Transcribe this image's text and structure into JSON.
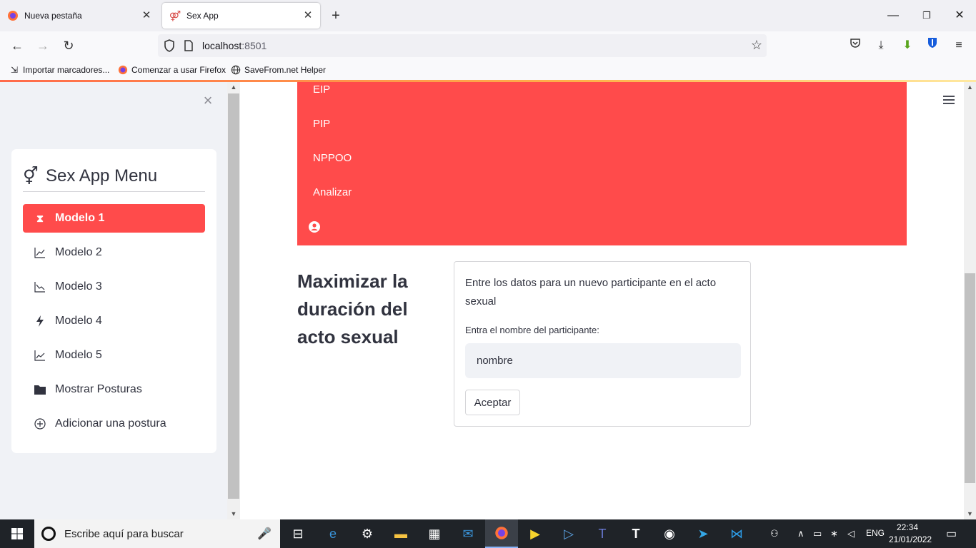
{
  "browser": {
    "tabs": [
      {
        "label": "Nueva pestaña"
      },
      {
        "label": "Sex App"
      }
    ],
    "url_host": "localhost",
    "url_port": ":8501",
    "bookmarks": [
      {
        "label": "Importar marcadores..."
      },
      {
        "label": "Comenzar a usar Firefox"
      },
      {
        "label": "SaveFrom.net Helper"
      }
    ]
  },
  "sidebar": {
    "title": "Sex App Menu",
    "items": [
      {
        "label": "Modelo 1",
        "icon": "hourglass-icon",
        "active": true
      },
      {
        "label": "Modelo 2",
        "icon": "chart-up-icon"
      },
      {
        "label": "Modelo 3",
        "icon": "chart-down-icon"
      },
      {
        "label": "Modelo 4",
        "icon": "lightning-icon"
      },
      {
        "label": "Modelo 5",
        "icon": "line-chart-icon"
      },
      {
        "label": "Mostrar Posturas",
        "icon": "folder-icon"
      },
      {
        "label": "Adicionar una postura",
        "icon": "plus-circle-icon"
      }
    ]
  },
  "topnav": {
    "links": [
      {
        "label": "EIP"
      },
      {
        "label": "PIP"
      },
      {
        "label": "NPPOO"
      },
      {
        "label": "Analizar"
      }
    ]
  },
  "main": {
    "heading": "Maximizar la duración del acto sexual",
    "form": {
      "description": "Entre los datos para un nuevo participante en el acto sexual",
      "label": "Entra el nombre del participante:",
      "input_value": "nombre",
      "button": "Aceptar"
    }
  },
  "taskbar": {
    "search_placeholder": "Escribe aquí para buscar",
    "language": "ENG",
    "time": "22:34",
    "date": "21/01/2022"
  },
  "colors": {
    "accent": "#ff4b4b",
    "sidebar_bg": "#f0f2f6",
    "text": "#31333f"
  }
}
